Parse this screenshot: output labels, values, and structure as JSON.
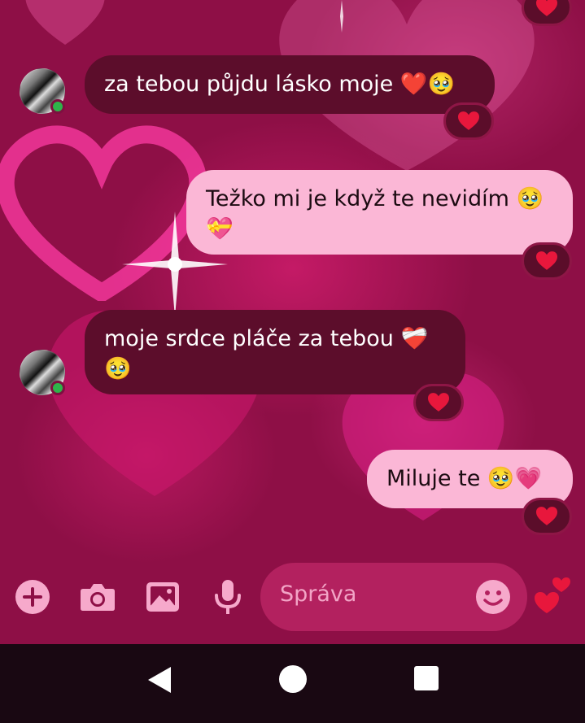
{
  "messages": [
    {
      "sender": "contact",
      "text": "za tebou půjdu lásko moje ❤️🥹",
      "reaction": "heart",
      "online": true
    },
    {
      "sender": "me",
      "text": "Težko mi je když te nevidím 🥹 💝",
      "reaction": "heart"
    },
    {
      "sender": "contact",
      "text": "moje srdce pláče za tebou ❤️‍🩹 🥹",
      "reaction": "heart",
      "online": true
    },
    {
      "sender": "me",
      "text": "Miluje te 🥹💗",
      "reaction": "heart"
    }
  ],
  "composer": {
    "placeholder": "Správa",
    "buttons": [
      "add-icon",
      "camera-icon",
      "image-icon",
      "microphone-icon"
    ],
    "emoji_button": "smile-icon",
    "send_button": "double-heart-icon"
  },
  "navigation": {
    "buttons": [
      "back",
      "home",
      "recents"
    ]
  },
  "colors": {
    "incoming_bubble": "#5c0d2b",
    "outgoing_bubble": "#fbb7d6",
    "online_indicator": "#2fb34a",
    "reaction_heart": "#e8173c"
  }
}
